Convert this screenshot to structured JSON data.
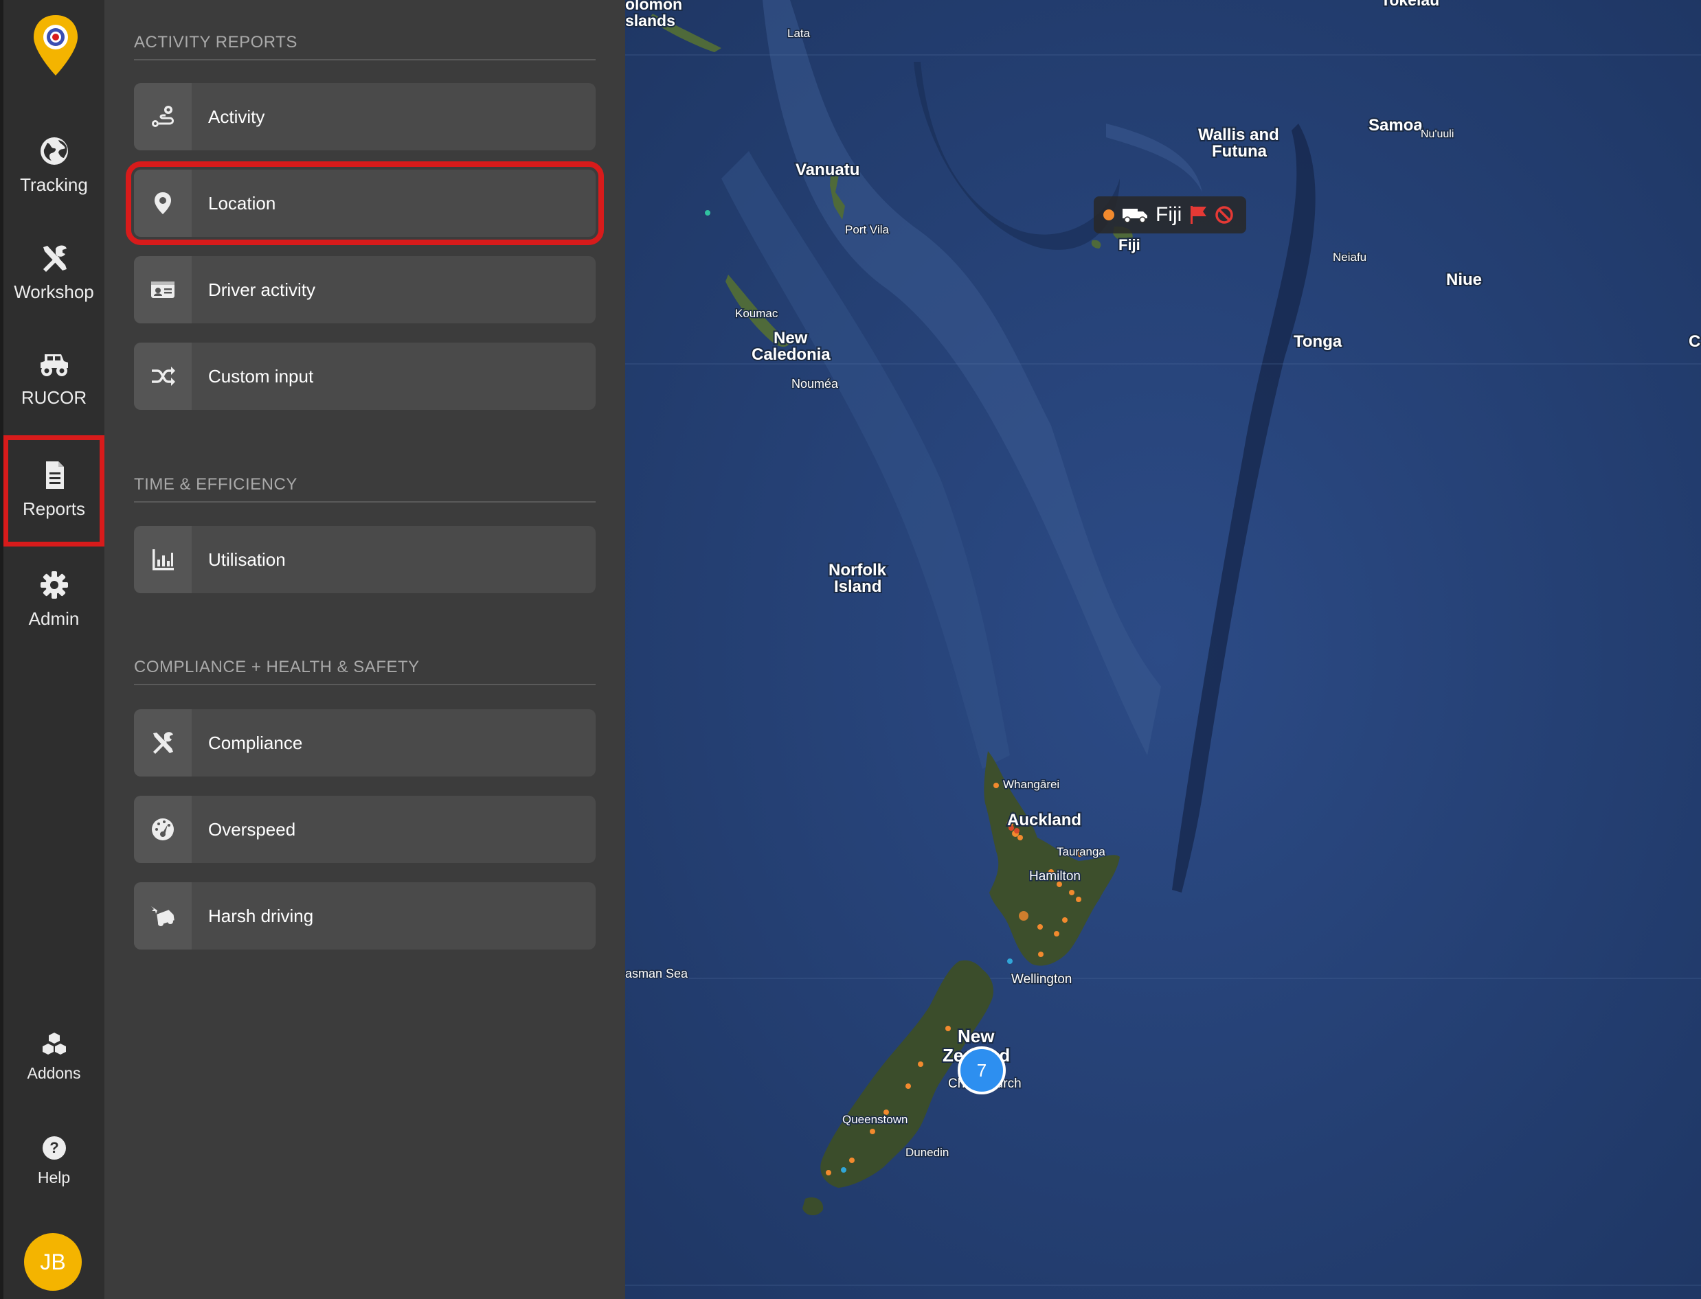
{
  "rail": {
    "items": [
      {
        "label": "Tracking",
        "icon": "globe-icon"
      },
      {
        "label": "Workshop",
        "icon": "tools-icon"
      },
      {
        "label": "RUCOR",
        "icon": "truck-icon"
      },
      {
        "label": "Reports",
        "icon": "document-icon"
      },
      {
        "label": "Admin",
        "icon": "gear-icon"
      }
    ],
    "addons_label": "Addons",
    "help_label": "Help",
    "avatar_initials": "JB"
  },
  "panel": {
    "sections": [
      {
        "title": "ACTIVITY REPORTS",
        "items": [
          "Activity",
          "Location",
          "Driver activity",
          "Custom input"
        ]
      },
      {
        "title": "TIME & EFFICIENCY",
        "items": [
          "Utilisation"
        ]
      },
      {
        "title": "COMPLIANCE + HEALTH & SAFETY",
        "items": [
          "Compliance",
          "Overspeed",
          "Harsh driving"
        ]
      }
    ],
    "highlighted_item": "Location"
  },
  "map": {
    "labels": {
      "solomon": "olomon\nslands",
      "tokelau": "Tokelau",
      "lata": "Lata",
      "vanuatu": "Vanuatu",
      "port_vila": "Port Vila",
      "wallis": "Wallis and",
      "futuna": "Futuna",
      "samoa": "Samoa",
      "nuuli": "Nu'uuli",
      "fiji": "Fiji",
      "neiafu": "Neiafu",
      "niue": "Niue",
      "tonga": "Tonga",
      "koumac": "Koumac",
      "new": "New",
      "caledonia": "Caledonia",
      "noumea": "Nouméa",
      "norfolk": "Norfolk",
      "island": "Island",
      "whangarei": "Whangārei",
      "auckland": "Auckland",
      "tauranga": "Tauranga",
      "hamilton": "Hamilton",
      "wellington": "Wellington",
      "tasman": "asman Sea",
      "nz_new": "New",
      "nz_zealand": "Zealand",
      "christchurch": "Christchurch",
      "queenstown": "Queenstown",
      "dunedin": "Dunedin",
      "edge_c": "C"
    },
    "popup_name": "Fiji",
    "cluster_count": "7",
    "colors": {
      "ocean": "#24406f",
      "land": "#3d4f2c",
      "accent": "#d81b1b",
      "cluster": "#2d8ff0",
      "dot": "#f28a2e"
    }
  }
}
